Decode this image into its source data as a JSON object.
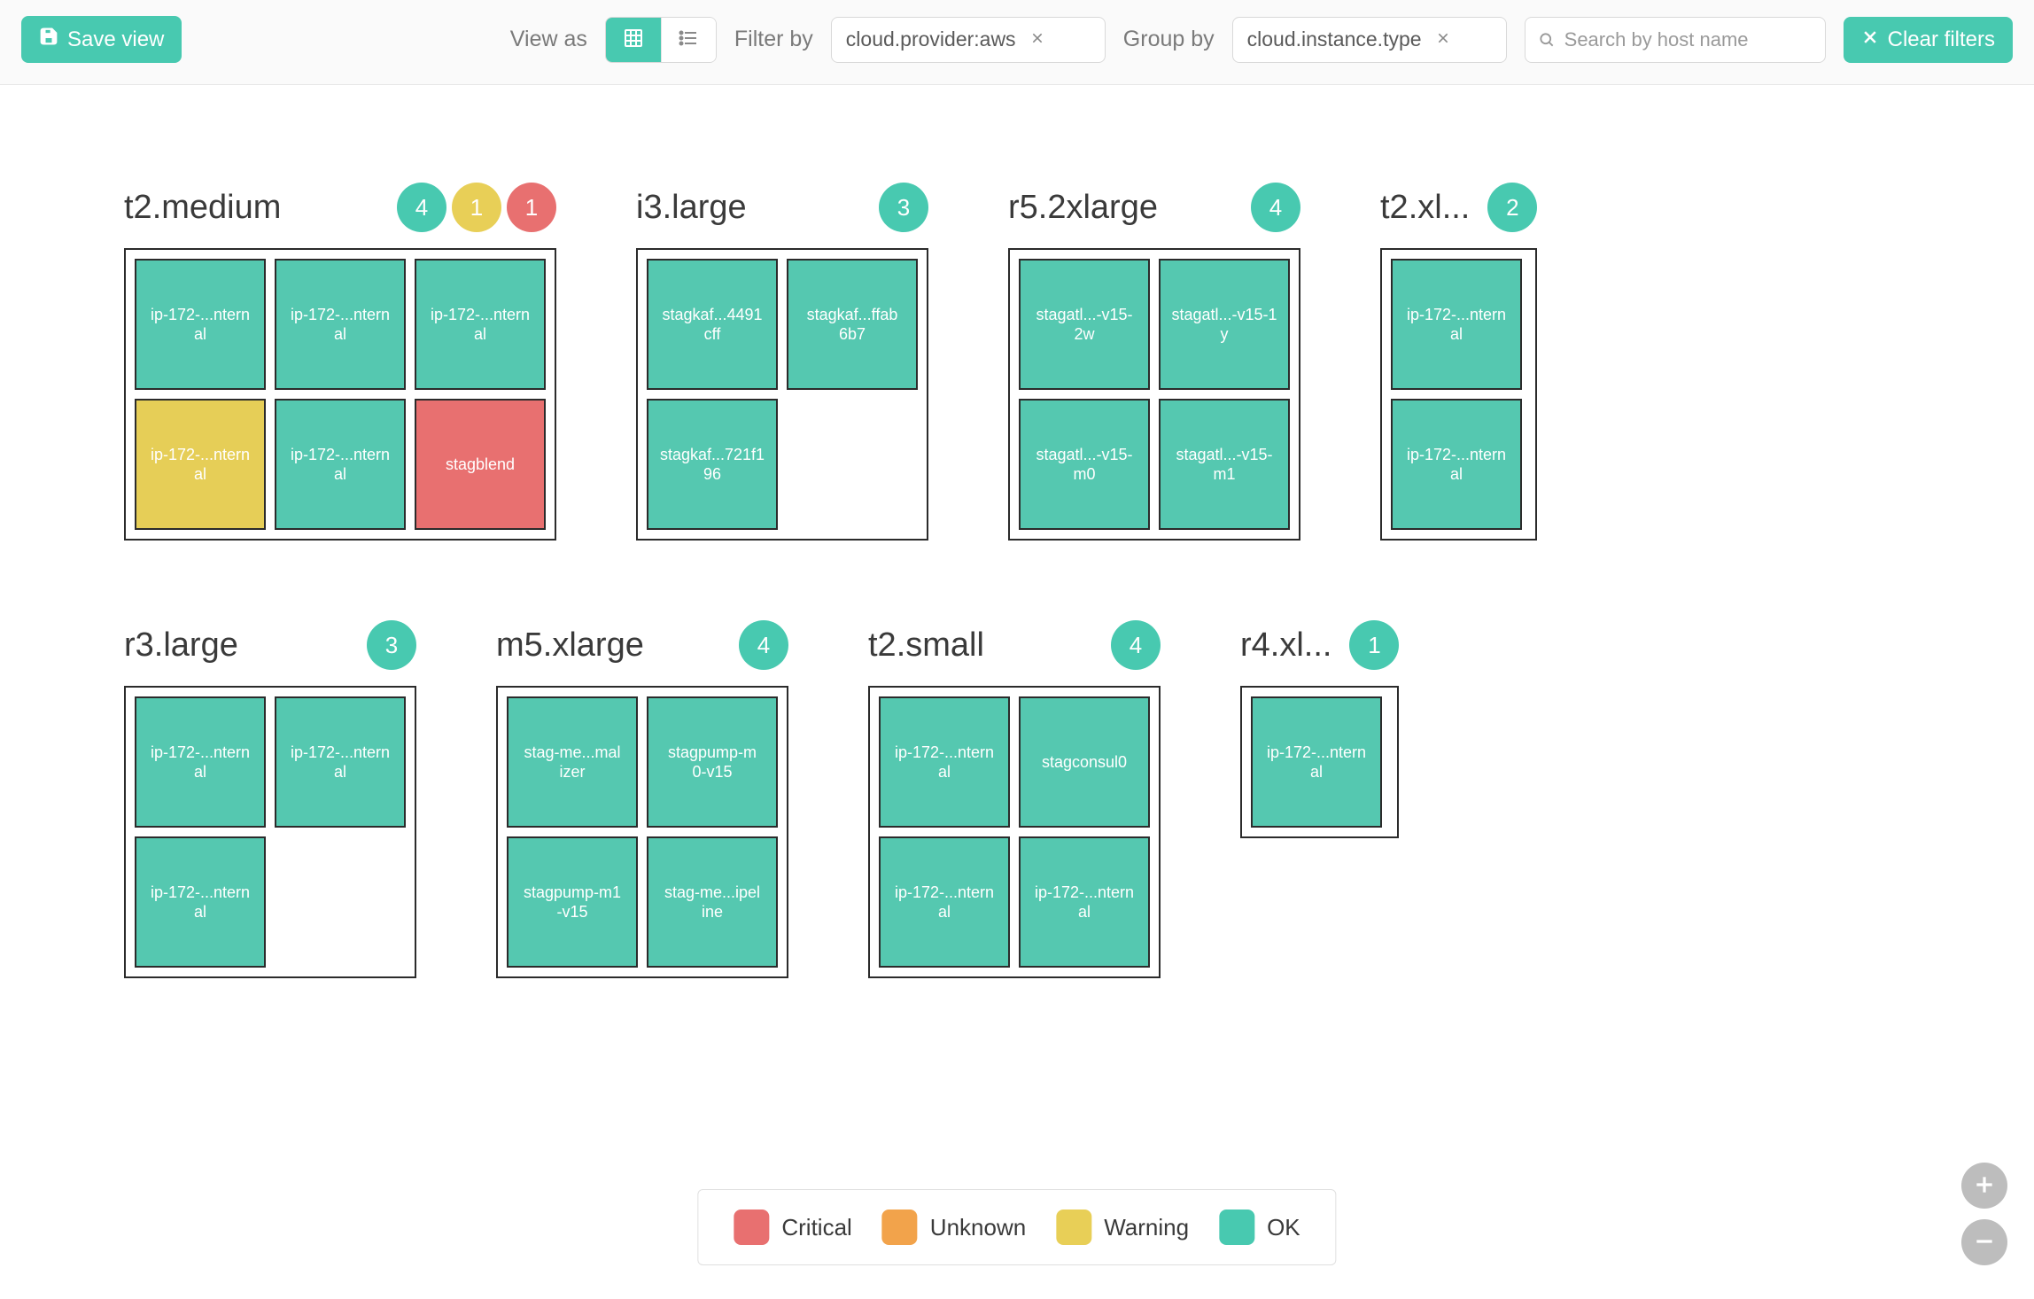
{
  "toolbar": {
    "save_view": "Save view",
    "view_as": "View as",
    "filter_by": "Filter by",
    "filter_chip": "cloud.provider:aws",
    "group_by": "Group by",
    "group_chip": "cloud.instance.type",
    "search_placeholder": "Search by host name",
    "clear_filters": "Clear filters"
  },
  "colors": {
    "ok": "#48c9b0",
    "warning": "#e8cf57",
    "critical": "#e87070",
    "unknown": "#f2a34b"
  },
  "legend": {
    "critical": "Critical",
    "unknown": "Unknown",
    "warning": "Warning",
    "ok": "OK"
  },
  "groups_row1": [
    {
      "title": "t2.medium",
      "cols": 3,
      "badges": [
        {
          "count": "4",
          "status": "ok"
        },
        {
          "count": "1",
          "status": "warn"
        },
        {
          "count": "1",
          "status": "crit"
        }
      ],
      "hosts": [
        {
          "label": "ip-172-...ntern\nal",
          "status": "ok"
        },
        {
          "label": "ip-172-...ntern\nal",
          "status": "ok"
        },
        {
          "label": "ip-172-...ntern\nal",
          "status": "ok"
        },
        {
          "label": "ip-172-...ntern\nal",
          "status": "warn"
        },
        {
          "label": "ip-172-...ntern\nal",
          "status": "ok"
        },
        {
          "label": "stagblend",
          "status": "crit"
        }
      ]
    },
    {
      "title": "i3.large",
      "cols": 2,
      "badges": [
        {
          "count": "3",
          "status": "ok"
        }
      ],
      "hosts": [
        {
          "label": "stagkaf...4491\ncff",
          "status": "ok"
        },
        {
          "label": "stagkaf...ffab\n6b7",
          "status": "ok"
        },
        {
          "label": "stagkaf...721f1\n96",
          "status": "ok"
        },
        {
          "label": "",
          "status": "empty"
        }
      ]
    },
    {
      "title": "r5.2xlarge",
      "cols": 2,
      "badges": [
        {
          "count": "4",
          "status": "ok"
        }
      ],
      "hosts": [
        {
          "label": "stagatl...-v15-\n2w",
          "status": "ok"
        },
        {
          "label": "stagatl...-v15-1\ny",
          "status": "ok"
        },
        {
          "label": "stagatl...-v15-\nm0",
          "status": "ok"
        },
        {
          "label": "stagatl...-v15-\nm1",
          "status": "ok"
        }
      ]
    },
    {
      "title": "t2.xl...",
      "cols": 1,
      "badges": [
        {
          "count": "2",
          "status": "ok"
        }
      ],
      "hosts": [
        {
          "label": "ip-172-...ntern\nal",
          "status": "ok"
        },
        {
          "label": "ip-172-...ntern\nal",
          "status": "ok"
        }
      ]
    }
  ],
  "groups_row2": [
    {
      "title": "r3.large",
      "cols": 2,
      "badges": [
        {
          "count": "3",
          "status": "ok"
        }
      ],
      "hosts": [
        {
          "label": "ip-172-...ntern\nal",
          "status": "ok"
        },
        {
          "label": "ip-172-...ntern\nal",
          "status": "ok"
        },
        {
          "label": "ip-172-...ntern\nal",
          "status": "ok"
        },
        {
          "label": "",
          "status": "empty"
        }
      ]
    },
    {
      "title": "m5.xlarge",
      "cols": 2,
      "badges": [
        {
          "count": "4",
          "status": "ok"
        }
      ],
      "hosts": [
        {
          "label": "stag-me...mal\nizer",
          "status": "ok"
        },
        {
          "label": "stagpump-m\n0-v15",
          "status": "ok"
        },
        {
          "label": "stagpump-m1\n-v15",
          "status": "ok"
        },
        {
          "label": "stag-me...ipel\nine",
          "status": "ok"
        }
      ]
    },
    {
      "title": "t2.small",
      "cols": 2,
      "badges": [
        {
          "count": "4",
          "status": "ok"
        }
      ],
      "hosts": [
        {
          "label": "ip-172-...ntern\nal",
          "status": "ok"
        },
        {
          "label": "stagconsul0",
          "status": "ok"
        },
        {
          "label": "ip-172-...ntern\nal",
          "status": "ok"
        },
        {
          "label": "ip-172-...ntern\nal",
          "status": "ok"
        }
      ]
    },
    {
      "title": "r4.xl...",
      "cols": 1,
      "badges": [
        {
          "count": "1",
          "status": "ok"
        }
      ],
      "hosts": [
        {
          "label": "ip-172-...ntern\nal",
          "status": "ok"
        }
      ]
    }
  ]
}
